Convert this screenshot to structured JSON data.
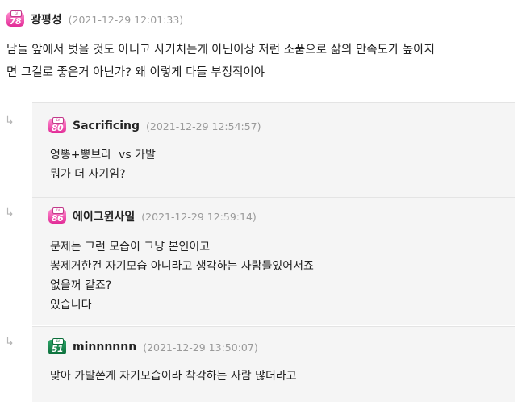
{
  "main_comment": {
    "level": "78",
    "badge_tag": "LV",
    "author": "광평성",
    "timestamp": "(2021-12-29 12:01:33)",
    "body_lines": [
      "남들 앞에서 벗을 것도 아니고 사기치는게 아닌이상 저런 소품으로 삶의 만족도가 높아지",
      "면 그걸로 좋은거 아닌가? 왜 이렇게 다들 부정적이야"
    ]
  },
  "replies": [
    {
      "level": "80",
      "badge_tag": "LV",
      "badge_color": "#e22b96",
      "author": "Sacrificing",
      "timestamp": "(2021-12-29 12:54:57)",
      "body_lines": [
        "엉뽕+뽕브라  vs 가발",
        "뭐가 더 사기임?"
      ]
    },
    {
      "level": "86",
      "badge_tag": "LV",
      "badge_color": "#e22b96",
      "author": "에이그윈사일",
      "timestamp": "(2021-12-29 12:59:14)",
      "body_lines": [
        "문제는 그런 모습이 그냥 본인이고",
        "뽕제거한건 자기모습 아니라고 생각하는 사람들있어서죠",
        "없을꺼 같죠?",
        "있습니다"
      ]
    },
    {
      "level": "51",
      "badge_tag": "LV",
      "badge_color": "#0b6e3a",
      "author": "minnnnnn",
      "timestamp": "(2021-12-29 13:50:07)",
      "body_lines": [
        "맞아 가발쓴게 자기모습이라 착각하는 사람 많더라고"
      ]
    }
  ],
  "icons": {
    "reply_arrow": "↳"
  }
}
